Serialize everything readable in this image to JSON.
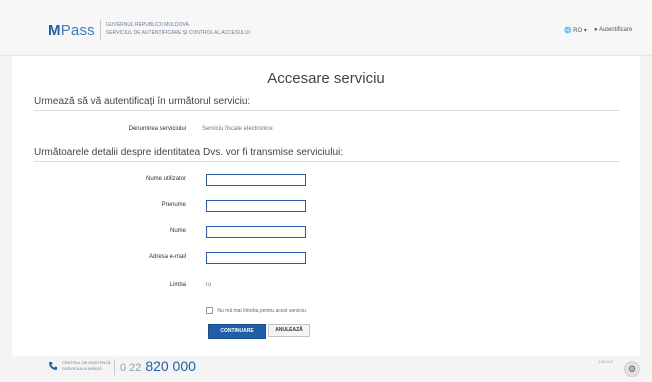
{
  "header": {
    "logo_m": "M",
    "logo_rest": "Pass",
    "sub_line1": "Guvernul Republicii Moldova",
    "sub_line2": "Serviciul de autentificare și control al accesului",
    "lang": "RO",
    "lang_caret": "▾",
    "login": "Autentificare"
  },
  "main": {
    "title": "Accesare serviciu",
    "section1": "Urmează să vă autentificați în următorul serviciu:",
    "service_label": "Denumirea serviciului",
    "service_value": "Serviciu fiscale electronice",
    "section2": "Următoarele detalii despre identitatea Dvs. vor fi transmise serviciului:",
    "fields": [
      {
        "label": "Nume utilizator",
        "value": ""
      },
      {
        "label": "Prenume",
        "value": ""
      },
      {
        "label": "Nume",
        "value": ""
      },
      {
        "label": "Adresa e-mail",
        "value": ""
      }
    ],
    "language_label": "Limba",
    "language_value": "ro",
    "checkbox_text": "Nu mă mai întreba pentru acest serviciu",
    "continue_label": "CONTINUARE",
    "cancel_label": "ANULEAZĂ"
  },
  "footer": {
    "label_line1": "Centrul de asistență",
    "label_line2": "Serviciului MPASS",
    "phone_prefix": "0 22",
    "phone_main": "820 000",
    "version": "1.83.0.0"
  },
  "colors": {
    "brand": "#1f5fa8",
    "input_border": "#2c5ca8"
  },
  "icons": [
    "phone-icon",
    "gear-icon",
    "globe-icon",
    "user-icon"
  ]
}
